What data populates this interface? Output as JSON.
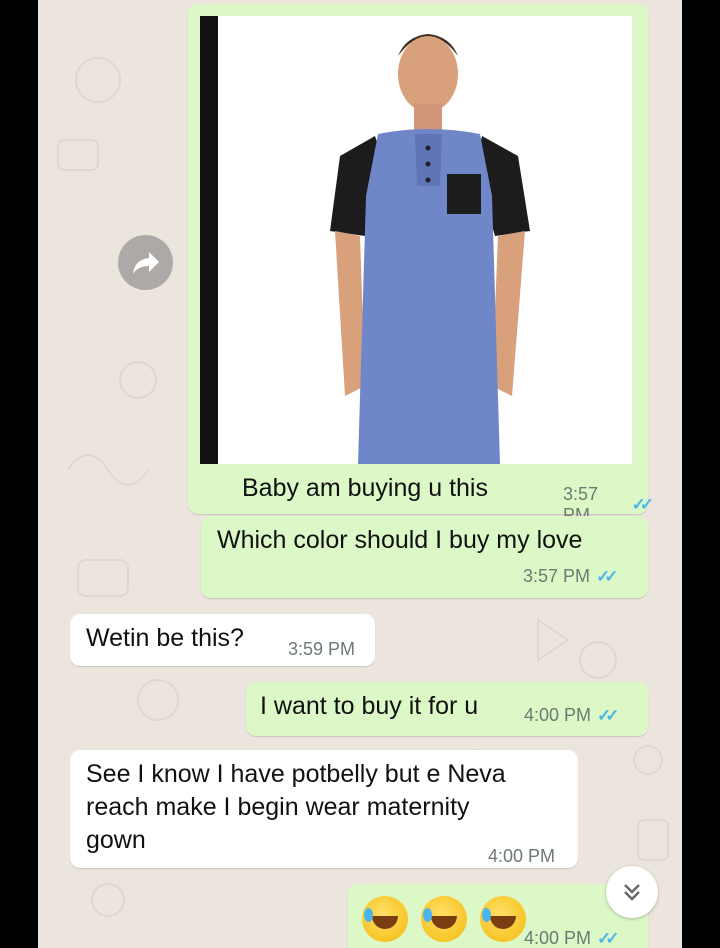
{
  "messages": [
    {
      "caption": "Baby am buying u this",
      "time": "3:57 PM",
      "ticks": "✓✓"
    },
    {
      "text": "Which color should I buy my love",
      "time": "3:57 PM",
      "ticks": "✓✓"
    },
    {
      "text": "Wetin be this?",
      "time": "3:59 PM"
    },
    {
      "text": "I want to buy it for u",
      "time": "4:00 PM",
      "ticks": "✓✓"
    },
    {
      "text_lines": [
        "See I know I have potbelly but e Neva",
        "reach make I begin wear maternity",
        "gown"
      ],
      "time": "4:00 PM"
    },
    {
      "time": "4:00 PM",
      "ticks": "✓✓",
      "emoji_count": 3
    }
  ],
  "icons": {
    "forward": "forward-arrow-icon",
    "scroll": "double-chevron-down-icon",
    "ticks_color": "#4fb6ec"
  },
  "colors": {
    "outgoing_bubble": "#dcf8c6",
    "incoming_bubble": "#ffffff",
    "wallpaper": "#ece5dd",
    "nightshirt": "#6f86c8"
  }
}
